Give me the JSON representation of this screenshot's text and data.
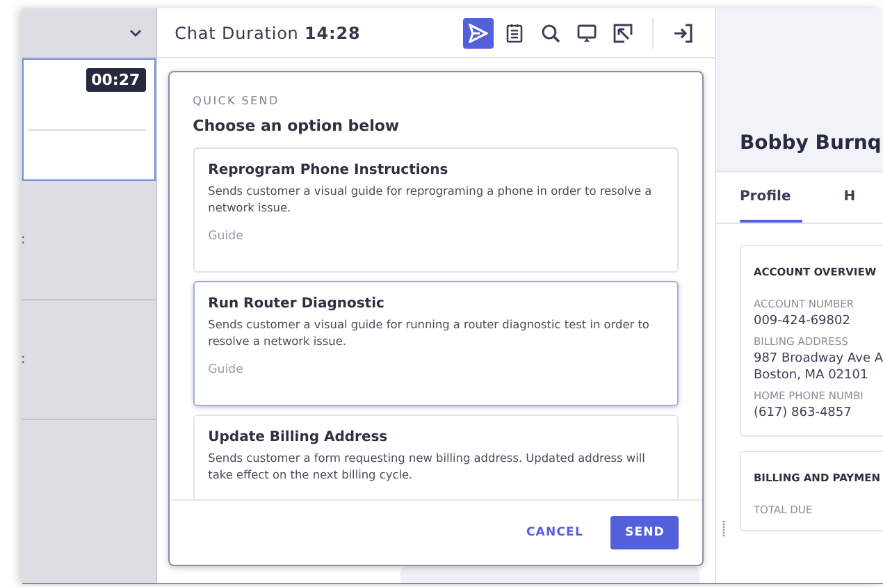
{
  "queue": {
    "timer": "00:27",
    "row_marks": [
      ":",
      ":"
    ]
  },
  "chat": {
    "title": "Chat Duration",
    "duration": "14:28",
    "tools": [
      {
        "kind": "send",
        "selected": true
      },
      {
        "kind": "notes",
        "selected": false
      },
      {
        "kind": "search",
        "selected": false
      },
      {
        "kind": "screen",
        "selected": false
      },
      {
        "kind": "pointer",
        "selected": false
      },
      {
        "kind": "exit",
        "selected": false
      }
    ]
  },
  "quick_send": {
    "label": "QUICK SEND",
    "heading": "Choose an option below",
    "options": [
      {
        "title": "Reprogram Phone Instructions",
        "description": "Sends customer a visual guide for reprograming a phone in order to resolve a network issue.",
        "type": "Guide",
        "selected": false
      },
      {
        "title": "Run Router Diagnostic",
        "description": "Sends customer a visual guide for running a router diagnostic test in order to resolve a network issue.",
        "type": "Guide",
        "selected": true
      },
      {
        "title": "Update Billing Address",
        "description": "Sends customer a form requesting new billing address. Updated address will take effect on the next billing cycle.",
        "selected": false
      }
    ],
    "buttons": [
      "CANCEL",
      "SEND"
    ]
  },
  "customer": {
    "name": "Bobby Burnq",
    "tabs": [
      {
        "label": "Profile",
        "selected": true
      },
      {
        "label": "H",
        "selected": false
      }
    ],
    "account_overview": {
      "title": "ACCOUNT OVERVIEW",
      "fields": [
        {
          "label": "ACCOUNT NUMBER",
          "value": "009-424-69802"
        },
        {
          "label": "BILLING ADDRESS",
          "value": "987 Broadway Ave A\nBoston, MA 02101"
        },
        {
          "label": "HOME PHONE NUMBI",
          "value": "(617) 863-4857"
        }
      ]
    },
    "billing": {
      "title": "BILLING AND PAYMEN",
      "fields": [
        {
          "label": "TOTAL DUE"
        }
      ]
    }
  }
}
